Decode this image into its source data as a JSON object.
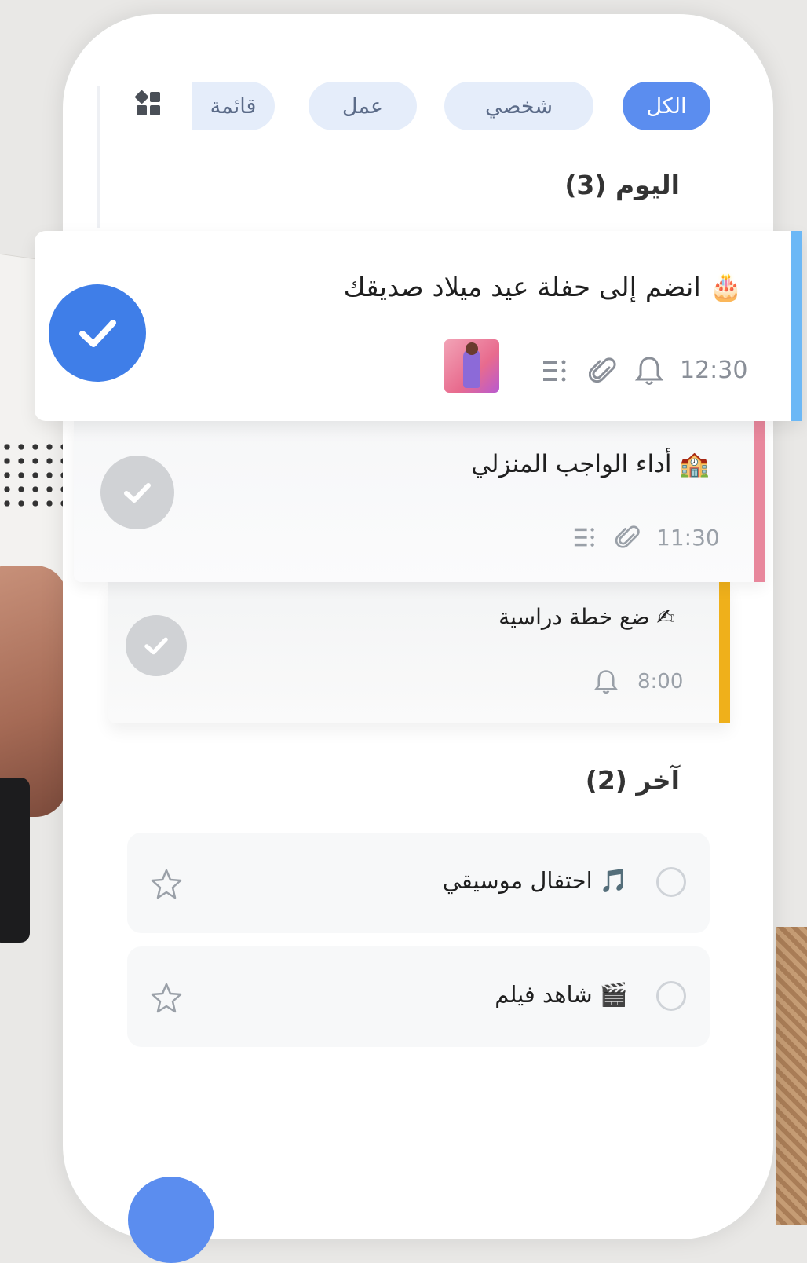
{
  "filters": {
    "all": "الكل",
    "personal": "شخصي",
    "work": "عمل",
    "list": "قائمة",
    "active": "all"
  },
  "sections": {
    "today": "اليوم (3)",
    "other": "آخر (2)"
  },
  "today_tasks": [
    {
      "emoji": "🎂",
      "title": "انضم إلى حفلة عيد ميلاد صديقك",
      "time": "12:30",
      "completed": true,
      "accent": "#6cb8f6",
      "icons": [
        "bell-icon",
        "attachment-icon",
        "subtasks-icon",
        "photo-thumbnail"
      ]
    },
    {
      "emoji": "🏫",
      "title": "أداء الواجب المنزلي",
      "time": "11:30",
      "completed": true,
      "accent": "#e8879c",
      "icons": [
        "attachment-icon",
        "subtasks-icon"
      ]
    },
    {
      "emoji": "✍",
      "title": "ضع خطة دراسية",
      "time": "8:00",
      "completed": true,
      "accent": "#efb01b",
      "icons": [
        "bell-icon"
      ]
    }
  ],
  "other_tasks": [
    {
      "emoji": "🎵",
      "title": "احتفال موسيقي",
      "starred": false
    },
    {
      "emoji": "🎬",
      "title": "شاهد فيلم",
      "starred": false
    }
  ],
  "colors": {
    "primary": "#5b8def",
    "chip_bg": "#e5edfa",
    "check_done": "#3f7ee8",
    "check_muted": "#d0d2d5"
  }
}
